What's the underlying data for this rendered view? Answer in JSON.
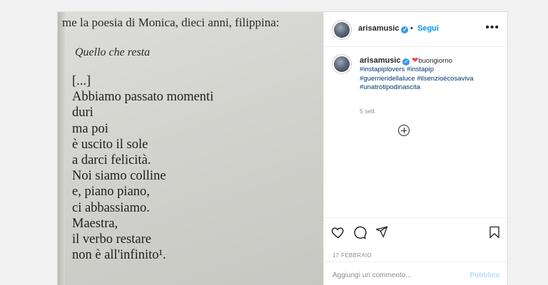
{
  "photo": {
    "top_line": "me la poesia di Monica, dieci anni, filippina:",
    "title": "Quello che resta",
    "lines": [
      "[...]",
      "Abbiamo passato momenti",
      "duri",
      "ma poi",
      "è uscito il sole",
      "a darci felicità.",
      "Noi siamo colline",
      "e, piano piano,",
      "ci abbassiamo.",
      "Maestra,",
      "il verbo restare",
      "non è all'infinito¹."
    ]
  },
  "header": {
    "username": "arisamusic",
    "verified_mark": "✓",
    "separator": "•",
    "follow_label": "Segui",
    "more": "•••"
  },
  "caption": {
    "username": "arisamusic",
    "text": "buongiorno",
    "heart": "❤",
    "hashtags_line1": "#instapiplovers #instapip",
    "hashtags_line2": "#guerrieridellaluce #ilsenzioècosaviva",
    "hashtags_line3": "#unatrotipodinascita",
    "time": "5 sett."
  },
  "actions": {
    "date": "17 FEBBRAIO"
  },
  "comment": {
    "placeholder": "Aggiungi un commento...",
    "publish_label": "Pubblica"
  },
  "colors": {
    "accent": "#0095f6",
    "verified": "#3897f0",
    "heart": "#ed4956",
    "publish_disabled": "#b2dffc"
  },
  "icons": [
    "more-options-icon",
    "load-comments-icon",
    "heart-icon",
    "comment-icon",
    "share-icon",
    "bookmark-icon",
    "verified-icon"
  ]
}
